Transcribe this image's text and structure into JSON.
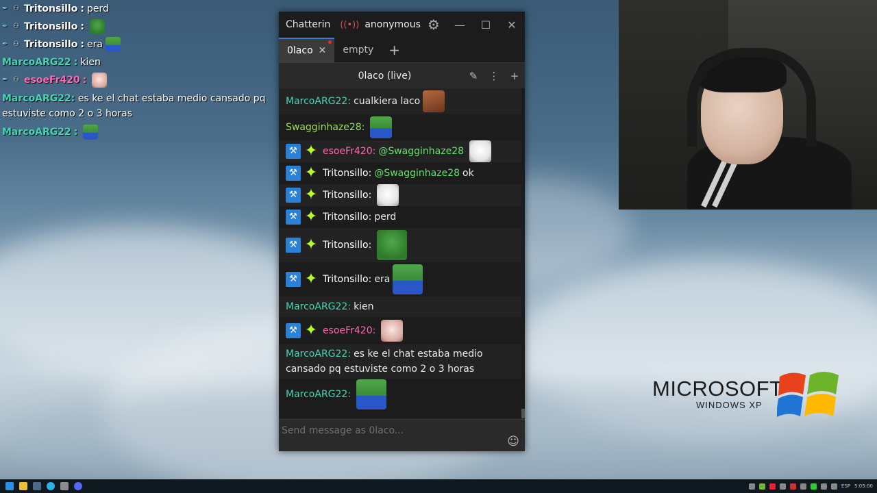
{
  "overlay": {
    "messages": [
      {
        "user": "Tritonsillo",
        "text": "perd",
        "kind": "trit"
      },
      {
        "user": "Tritonsillo",
        "text": "",
        "emote": "pepe",
        "kind": "trit"
      },
      {
        "user": "Tritonsillo",
        "text": "era",
        "emote": "pepewave",
        "kind": "trit"
      },
      {
        "user": "MarcoARG22",
        "text": "kien",
        "kind": "marco"
      },
      {
        "user": "esoeFr420",
        "text": "",
        "emote": "cat",
        "kind": "eso"
      },
      {
        "user": "MarcoARG22",
        "text": "es ke el chat estaba medio cansado pq estuviste como 2 o 3 horas",
        "kind": "marco"
      },
      {
        "user": "MarcoARG22",
        "text": "",
        "emote": "pepewave",
        "kind": "marco"
      }
    ]
  },
  "window": {
    "app_name": "Chatterin",
    "live_icon": "((•))",
    "account": "anonymous",
    "tabs": [
      {
        "label": "0laco",
        "active": true
      },
      {
        "label": "empty",
        "active": false
      }
    ],
    "channel_title": "0laco (live)",
    "input_placeholder": "Send message as 0laco...",
    "messages": [
      {
        "user": "MarcoARG22",
        "text": "cualkiera laco",
        "emote": "face",
        "badges": false,
        "color": "marco"
      },
      {
        "user": "Swagginhaze28",
        "text": "",
        "emote": "pepewave",
        "badges": false,
        "color": "swag"
      },
      {
        "user": "esoeFr420",
        "mention": "@Swagginhaze28",
        "text": "",
        "emote": "cat2",
        "badges": true,
        "color": "eso"
      },
      {
        "user": "Tritonsillo",
        "mention": "@Swagginhaze28",
        "text": "ok",
        "badges": true,
        "color": "trit"
      },
      {
        "user": "Tritonsillo",
        "text": "",
        "emote": "cat2",
        "badges": true,
        "color": "trit"
      },
      {
        "user": "Tritonsillo",
        "text": "perd",
        "badges": true,
        "color": "trit"
      },
      {
        "user": "Tritonsillo",
        "text": "",
        "emote": "pepe",
        "badges": true,
        "color": "trit"
      },
      {
        "user": "Tritonsillo",
        "text": "era",
        "emote": "pepewave",
        "badges": true,
        "color": "trit"
      },
      {
        "user": "MarcoARG22",
        "text": "kien",
        "badges": false,
        "color": "marco"
      },
      {
        "user": "esoeFr420",
        "text": "",
        "emote": "cat",
        "badges": true,
        "color": "eso"
      },
      {
        "user": "MarcoARG22",
        "text": "es ke el chat estaba medio cansado pq estuviste como 2 o 3 horas",
        "badges": false,
        "color": "marco"
      },
      {
        "user": "MarcoARG22",
        "text": "",
        "emote": "pepewave",
        "badges": false,
        "color": "marco"
      }
    ]
  },
  "colors": {
    "marco": "#45d6b5",
    "swag": "#9ee05a",
    "eso": "#ff69b4",
    "trit": "#ffffff",
    "mention": "#65e36a"
  },
  "xp_logo": {
    "brand": "MICROSOFT",
    "product": "WINDOWS XP"
  },
  "taskbar": {
    "language": "ESP",
    "clock": "5:05:00"
  }
}
